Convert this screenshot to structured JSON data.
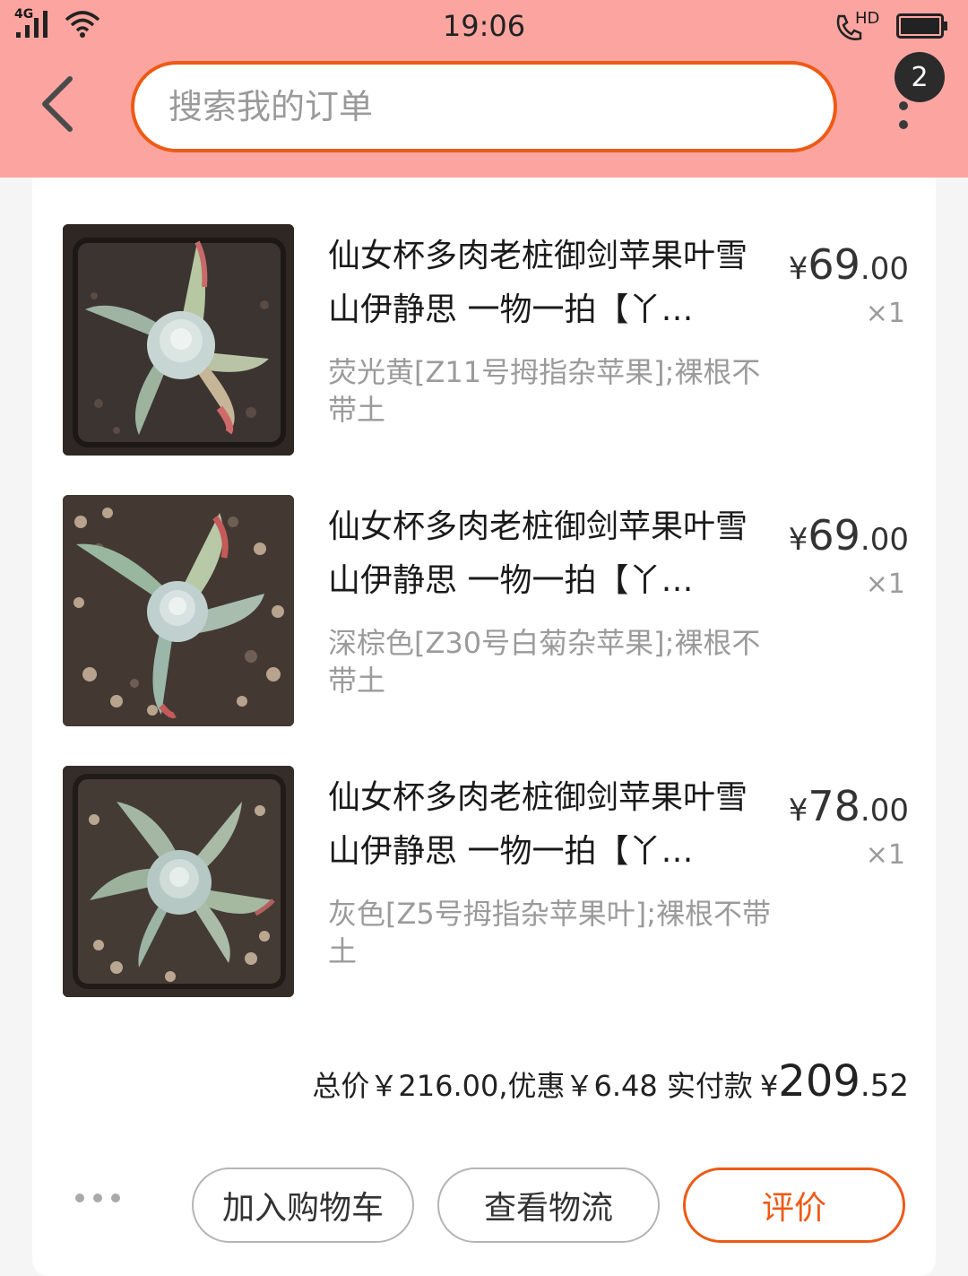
{
  "status_bar": {
    "time": "19:06",
    "network": "4G",
    "call_label": "HD"
  },
  "header": {
    "search_placeholder": "搜索我的订单",
    "badge_count": "2"
  },
  "items": [
    {
      "title": "仙女杯多肉老桩御剑苹果叶雪山伊静思 一物一拍【丫…",
      "spec": "荧光黄[Z11号拇指杂苹果];裸根不带土",
      "price_symbol": "¥",
      "price_int": "69",
      "price_dec": ".00",
      "qty": "×1"
    },
    {
      "title": "仙女杯多肉老桩御剑苹果叶雪山伊静思 一物一拍【丫…",
      "spec": "深棕色[Z30号白菊杂苹果];裸根不带土",
      "price_symbol": "¥",
      "price_int": "69",
      "price_dec": ".00",
      "qty": "×1"
    },
    {
      "title": "仙女杯多肉老桩御剑苹果叶雪山伊静思 一物一拍【丫…",
      "spec": "灰色[Z5号拇指杂苹果叶];裸根不带土",
      "price_symbol": "¥",
      "price_int": "78",
      "price_dec": ".00",
      "qty": "×1"
    }
  ],
  "summary": {
    "text": "总价￥216.00,优惠￥6.48 实付款",
    "paid_symbol": "¥",
    "paid_int": "209",
    "paid_dec": ".52"
  },
  "actions": {
    "add_to_cart": "加入购物车",
    "view_logistics": "查看物流",
    "review": "评价"
  },
  "colors": {
    "header_bg": "#fca5a0",
    "accent": "#ee5a16",
    "muted_text": "#9b9b9b"
  }
}
